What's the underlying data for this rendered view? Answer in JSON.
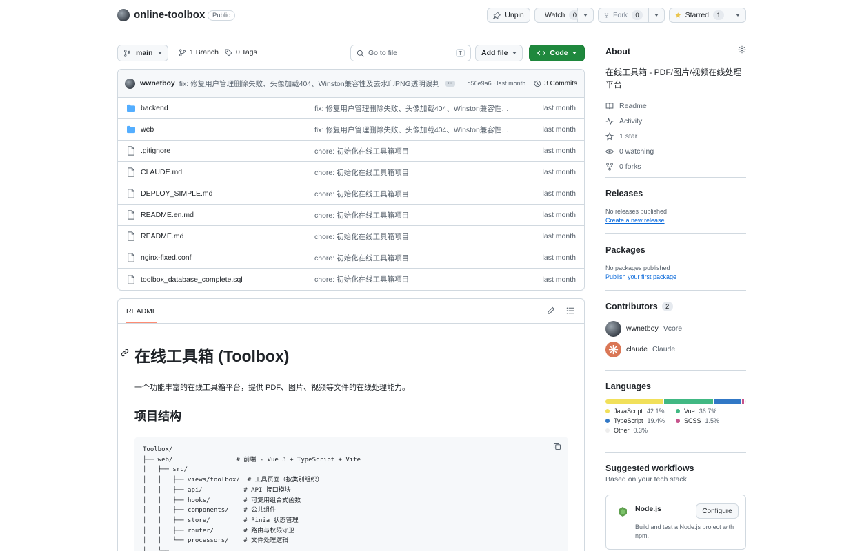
{
  "repo": {
    "name": "online-toolbox",
    "visibility": "Public"
  },
  "header_actions": {
    "unpin": "Unpin",
    "watch": "Watch",
    "watch_count": "0",
    "fork": "Fork",
    "fork_count": "0",
    "starred": "Starred",
    "star_count": "1"
  },
  "toolbar": {
    "branch": "main",
    "branches": "1 Branch",
    "tags": "0 Tags",
    "goto_placeholder": "Go to file",
    "goto_key": "T",
    "add_file": "Add file",
    "code": "Code"
  },
  "latest_commit": {
    "author": "wwnetboy",
    "message": "fix: 修复用户管理删除失败、头像加载404、Winston兼容性及去水印PNG透明误判",
    "meta": "d56e9a6 · last month",
    "commits": "3 Commits"
  },
  "files": [
    {
      "type": "dir",
      "name": "backend",
      "commit": "fix: 修复用户管理删除失败、头像加载404、Winston兼容性及去水印PNG透明误判",
      "date": "last month"
    },
    {
      "type": "dir",
      "name": "web",
      "commit": "fix: 修复用户管理删除失败、头像加载404、Winston兼容性及去水印PNG透明误判",
      "date": "last month"
    },
    {
      "type": "file",
      "name": ".gitignore",
      "commit": "chore: 初始化在线工具箱项目",
      "date": "last month"
    },
    {
      "type": "file",
      "name": "CLAUDE.md",
      "commit": "chore: 初始化在线工具箱项目",
      "date": "last month"
    },
    {
      "type": "file",
      "name": "DEPLOY_SIMPLE.md",
      "commit": "chore: 初始化在线工具箱项目",
      "date": "last month"
    },
    {
      "type": "file",
      "name": "README.en.md",
      "commit": "chore: 初始化在线工具箱项目",
      "date": "last month"
    },
    {
      "type": "file",
      "name": "README.md",
      "commit": "chore: 初始化在线工具箱项目",
      "date": "last month"
    },
    {
      "type": "file",
      "name": "nginx-fixed.conf",
      "commit": "chore: 初始化在线工具箱项目",
      "date": "last month"
    },
    {
      "type": "file",
      "name": "toolbox_database_complete.sql",
      "commit": "chore: 初始化在线工具箱项目",
      "date": "last month"
    }
  ],
  "readme": {
    "tab": "README",
    "h1": "在线工具箱 (Toolbox)",
    "intro": "一个功能丰富的在线工具箱平台，提供 PDF、图片、视频等文件的在线处理能力。",
    "h2": "项目结构",
    "code": [
      "Toolbox/",
      "├── web/                 # 前端 - Vue 3 + TypeScript + Vite",
      "│   ├── src/",
      "│   │   ├── views/toolbox/  # 工具页面（按类别组织）",
      "│   │   ├── api/           # API 接口模块",
      "│   │   ├── hooks/         # 可复用组合式函数",
      "│   │   ├── components/    # 公共组件",
      "│   │   ├── store/         # Pinia 状态管理",
      "│   │   ├── router/        # 路由与权限守卫",
      "│   │   └── processors/    # 文件处理逻辑",
      "│   └── ..."
    ]
  },
  "about": {
    "title": "About",
    "description": "在线工具箱 - PDF/图片/视频在线处理平台",
    "items": [
      {
        "icon": "book-icon",
        "label": "Readme"
      },
      {
        "icon": "pulse-icon",
        "label": "Activity"
      },
      {
        "icon": "star-icon",
        "label": "1 star"
      },
      {
        "icon": "eye-icon",
        "label": "0 watching"
      },
      {
        "icon": "fork-icon",
        "label": "0 forks"
      }
    ]
  },
  "releases": {
    "title": "Releases",
    "empty": "No releases published",
    "link": "Create a new release"
  },
  "packages": {
    "title": "Packages",
    "empty": "No packages published",
    "link": "Publish your first package"
  },
  "contributors": {
    "title": "Contributors",
    "count": "2",
    "list": [
      {
        "login": "wwnetboy",
        "name": "Vcore"
      },
      {
        "login": "claude",
        "name": "Claude"
      }
    ]
  },
  "languages": {
    "title": "Languages",
    "list": [
      {
        "name": "JavaScript",
        "pct": "42.1%",
        "value": 42.1,
        "color": "#f1e05a"
      },
      {
        "name": "Vue",
        "pct": "36.7%",
        "value": 36.7,
        "color": "#41b883"
      },
      {
        "name": "TypeScript",
        "pct": "19.4%",
        "value": 19.4,
        "color": "#3178c6"
      },
      {
        "name": "SCSS",
        "pct": "1.5%",
        "value": 1.5,
        "color": "#c6538c"
      },
      {
        "name": "Other",
        "pct": "0.3%",
        "value": 0.3,
        "color": "#ededed"
      }
    ]
  },
  "workflows": {
    "title": "Suggested workflows",
    "subtitle": "Based on your tech stack",
    "card_title": "Node.js",
    "card_desc": "Build and test a Node.js project with npm.",
    "configure": "Configure"
  }
}
